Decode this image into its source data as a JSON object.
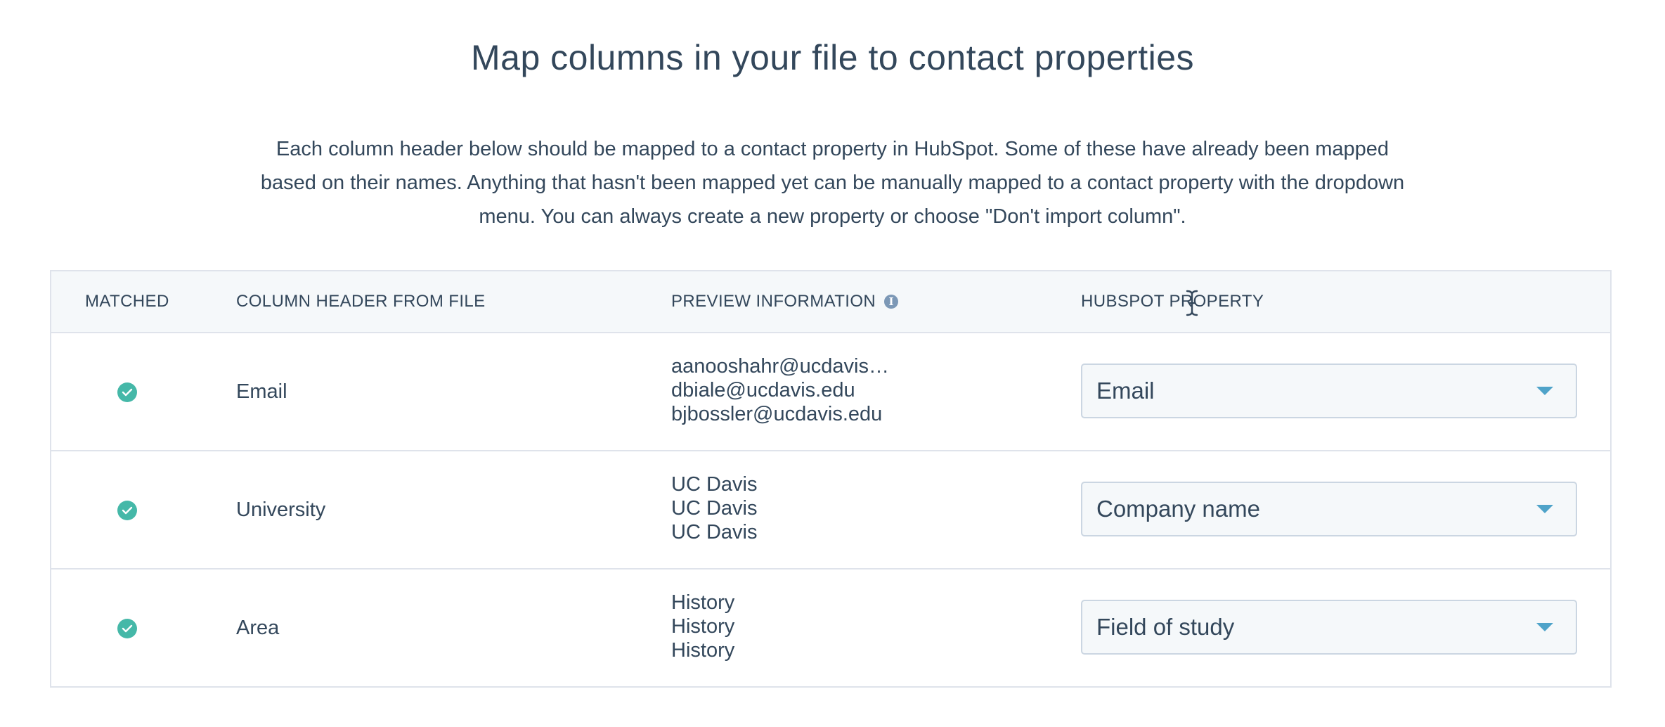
{
  "page": {
    "title": "Map columns in your file to contact properties",
    "description": "Each column header below should be mapped to a contact property in HubSpot. Some of these have already been mapped based on their names. Anything that hasn't been mapped yet can be manually mapped to a contact property with the dropdown menu. You can always create a new property or choose \"Don't import column\"."
  },
  "table": {
    "headers": {
      "matched": "MATCHED",
      "column_header": "COLUMN HEADER FROM FILE",
      "preview": "PREVIEW INFORMATION",
      "property": "HUBSPOT PROPERTY"
    },
    "rows": [
      {
        "matched": true,
        "column_header": "Email",
        "preview": [
          "aanooshahr@ucdavis…",
          "dbiale@ucdavis.edu",
          "bjbossler@ucdavis.edu"
        ],
        "property": "Email"
      },
      {
        "matched": true,
        "column_header": "University",
        "preview": [
          "UC Davis",
          "UC Davis",
          "UC Davis"
        ],
        "property": "Company name"
      },
      {
        "matched": true,
        "column_header": "Area",
        "preview": [
          "History",
          "History",
          "History"
        ],
        "property": "Field of study"
      }
    ]
  },
  "icons": {
    "matched": "check-circle-icon",
    "info": "info-icon",
    "dropdown": "caret-down-icon",
    "cursor": "text-cursor-icon"
  },
  "colors": {
    "text": "#33475b",
    "header_bg": "#f5f8fa",
    "border": "#dfe3eb",
    "check": "#45b8a8",
    "caret": "#4fa3c9"
  }
}
